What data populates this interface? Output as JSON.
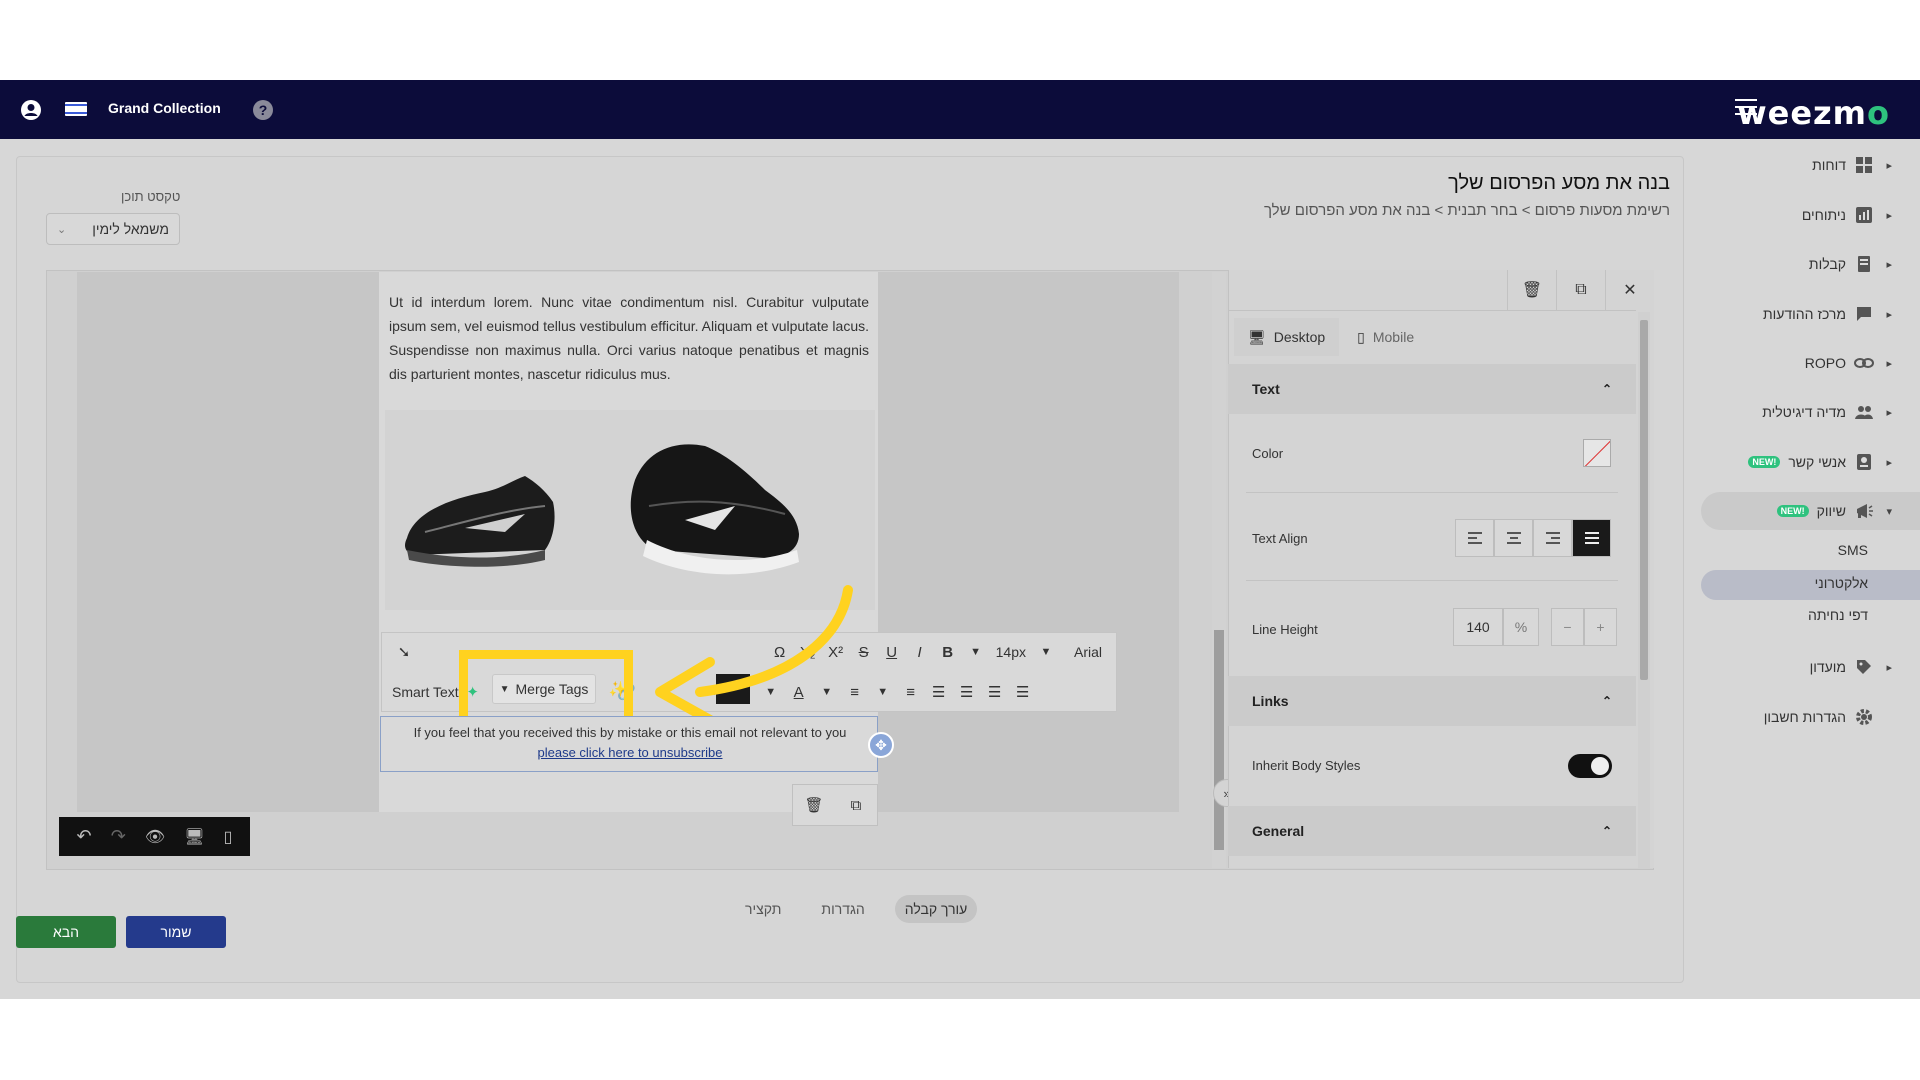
{
  "topbar": {
    "brand_prefix": "weezm",
    "brand_suffix": "o",
    "account_name": "Grand Collection"
  },
  "sidebar": {
    "items": [
      {
        "label": "דוחות",
        "icon": "grid-icon"
      },
      {
        "label": "ניתוחים",
        "icon": "chart-icon"
      },
      {
        "label": "קבלות",
        "icon": "receipt-icon"
      },
      {
        "label": "מרכז ההודעות",
        "icon": "chat-icon"
      },
      {
        "label": "ROPO",
        "icon": "link-icon"
      },
      {
        "label": "מדיה דיגיטלית",
        "icon": "people-icon"
      },
      {
        "label": "אנשי קשר",
        "icon": "contact-icon",
        "badge": "NEW!"
      },
      {
        "label": "שיווק",
        "icon": "megaphone-icon",
        "badge": "NEW!"
      },
      {
        "label": "מועדון",
        "icon": "tag-icon"
      },
      {
        "label": "הגדרות חשבון",
        "icon": "gear-icon"
      }
    ],
    "marketing_sub": [
      "SMS",
      "אלקטרוני",
      "דפי נחיתה"
    ]
  },
  "page": {
    "title": "בנה את מסע הפרסום שלך",
    "breadcrumb": "רשימת מסעות פרסום > בחר תבנית > בנה את מסע הפרסום שלך",
    "content_text_label": "טקסט תוכן",
    "direction_value": "משמאל לימין"
  },
  "email": {
    "body_text": "Ut id interdum lorem. Nunc vitae condimentum nisl. Curabitur vulputate ipsum sem, vel euismod tellus vestibulum efficitur. Aliquam et vulputate lacus. Suspendisse non maximus nulla. Orci varius natoque penatibus et magnis dis parturient montes, nascetur ridiculus mus.",
    "footer_text": "If you feel that you received this by mistake or this email not relevant to you",
    "unsubscribe_link": "please click here to unsubscribe"
  },
  "toolbar": {
    "font_size": "14px",
    "font_family": "Arial",
    "smart_text": "Smart Text",
    "merge_tags": "Merge Tags"
  },
  "settings": {
    "tabs": [
      "Desktop",
      "Mobile"
    ],
    "text_section": "Text",
    "color_label": "Color",
    "text_align_label": "Text Align",
    "line_height_label": "Line Height",
    "line_height_value": "140",
    "line_height_unit": "%",
    "links_section": "Links",
    "inherit_label": "Inherit Body Styles",
    "inherit_on": true,
    "general_section": "General"
  },
  "bottom": {
    "tabs": [
      "עורך קבלה",
      "הגדרות",
      "תקציר"
    ],
    "next_label": "הבא",
    "save_label": "שמור"
  },
  "colors": {
    "topbar": "#0c0c3a",
    "brand_accent": "#2ec27e",
    "highlight": "#ffd21f",
    "next_button": "#2a7a3b",
    "save_button": "#243a8c"
  }
}
